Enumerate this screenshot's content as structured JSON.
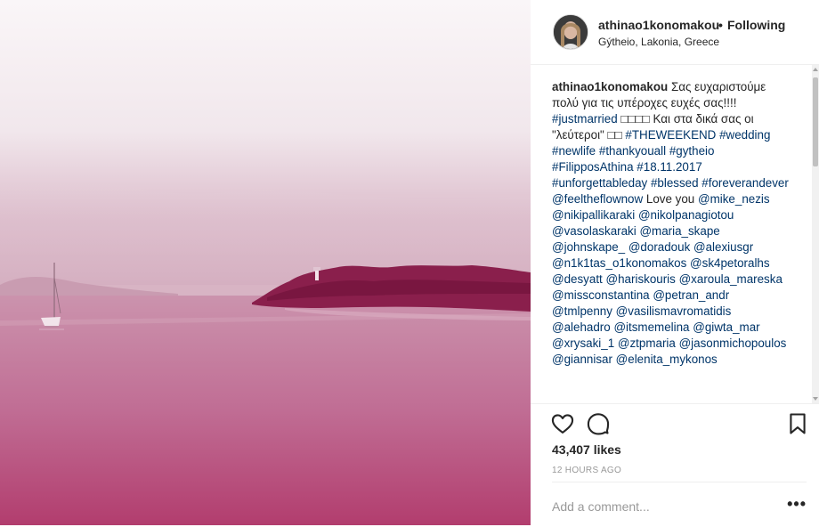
{
  "post": {
    "username": "athinao1konomakou",
    "separator": "•",
    "follow_status": "Following",
    "location": "Gýtheio, Lakonia, Greece",
    "caption": {
      "author": "athinao1konomakou",
      "line1_text": " Σας ευχαριστούμε πολύ για τις υπέροχες ευχές σας!!!!",
      "tag_justmarried": "#justmarried",
      "emoji_boxes": " □□□□ ",
      "greek_text": "Και στα δικά σας οι \"λεύτεροι\" □□ ",
      "tag_theweekend": "#THEWEEKEND",
      "tag_wedding": "#wedding",
      "tag_newlife": "#newlife",
      "tag_thankyouall": "#thankyouall",
      "tag_gytheio": "#gytheio",
      "tag_filipposathina": "#FilipposAthina",
      "tag_date": "#18.11.2017",
      "tag_unforgettableday": "#unforgettableday",
      "tag_blessed": "#blessed",
      "tag_foreverandever": "#foreverandever",
      "mention_feeltheflownow": "@feeltheflownow",
      "love_you": " Love you",
      "mentions": [
        "@mike_nezis",
        "@nikipallikaraki",
        "@nikolpanagiotou",
        "@vasolaskaraki",
        "@maria_skape",
        "@johnskape_",
        "@doradouk",
        "@alexiusgr",
        "@n1k1tas_o1konomakos",
        "@sk4petoralhs",
        "@desyatt",
        "@hariskouris",
        "@xaroula_mareska",
        "@missconstantina",
        "@petran_andr",
        "@tmlpenny",
        "@vasilismavromatidis",
        "@alehadro",
        "@itsmemelina",
        "@giwta_mar",
        "@xrysaki_1",
        "@ztpmaria",
        "@jasonmichopoulos",
        "@giannisar",
        "@elenita_mykonos"
      ]
    },
    "likes": "43,407 likes",
    "timestamp": "12 HOURS AGO",
    "comment_placeholder": "Add a comment...",
    "more_label": "•••"
  },
  "icons": {
    "like": "heart-icon",
    "comment": "comment-bubble-icon",
    "save": "bookmark-icon",
    "more": "more-options-icon"
  },
  "colors": {
    "photo_tint": "#b23d6e",
    "link": "#003569",
    "muted": "#999999",
    "text": "#262626"
  }
}
